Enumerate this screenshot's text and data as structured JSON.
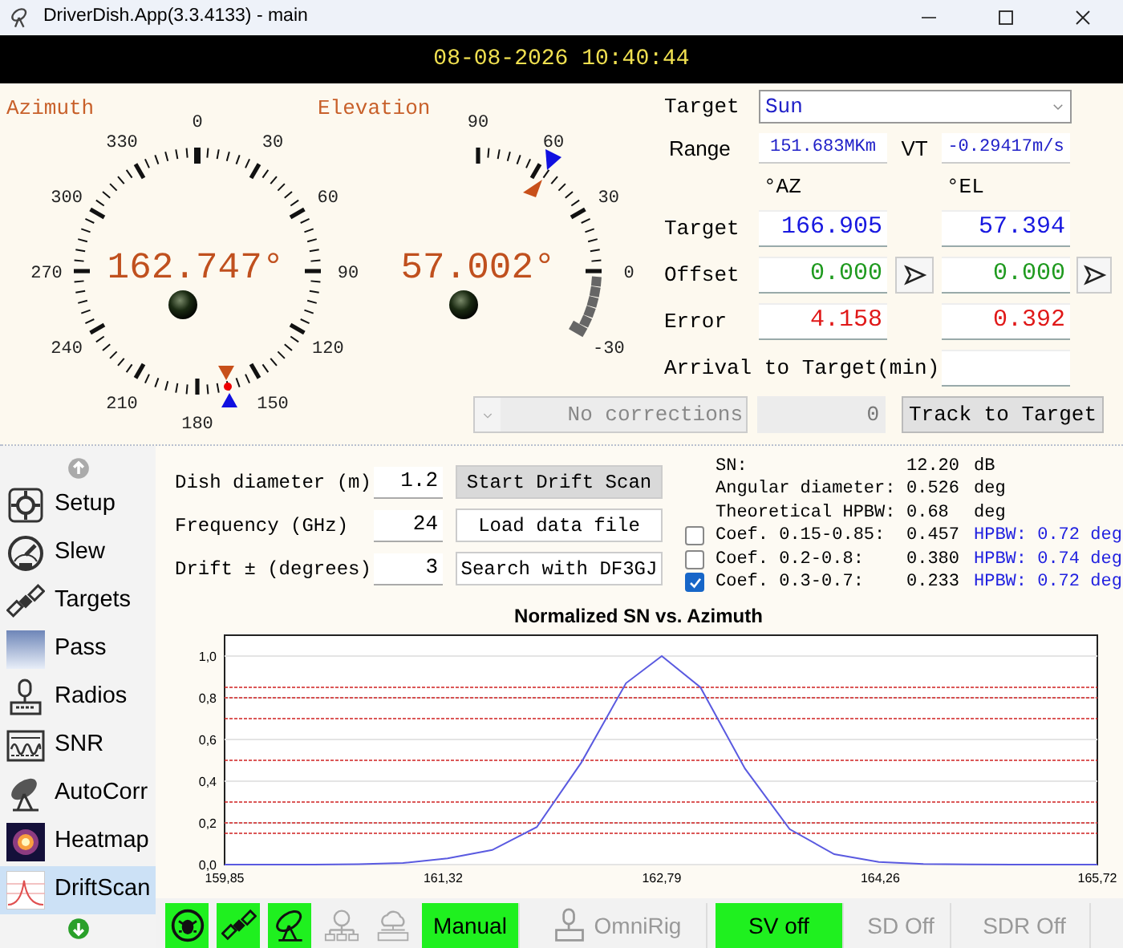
{
  "window": {
    "title": "DriverDish.App(3.3.4133) - main"
  },
  "clock": "08-08-2026 10:40:44",
  "azimuth": {
    "title": "Azimuth",
    "reading": "162.747°",
    "scale": [
      "0",
      "30",
      "60",
      "90",
      "120",
      "150",
      "180",
      "210",
      "240",
      "270",
      "300",
      "330"
    ]
  },
  "elevation": {
    "title": "Elevation",
    "reading": "57.002°",
    "scale": [
      "90",
      "60",
      "30",
      "0",
      "-30"
    ]
  },
  "target": {
    "label": "Target",
    "value": "Sun"
  },
  "range": {
    "label": "Range",
    "value": "151.683MKm"
  },
  "vt": {
    "label": "VT",
    "value": "-0.29417m/s"
  },
  "columns": [
    "°AZ",
    "°EL"
  ],
  "rows": [
    {
      "kind": "target",
      "label": "Target",
      "az": "166.905",
      "el": "57.394"
    },
    {
      "kind": "offset",
      "label": "Offset",
      "az": "0.000",
      "el": "0.000"
    },
    {
      "kind": "error",
      "label": "Error",
      "az": "4.158",
      "el": "0.392"
    }
  ],
  "arrival": {
    "label": "Arrival to Target(min)"
  },
  "corrections": {
    "value": "No corrections",
    "disabled": true
  },
  "correction_count": "0",
  "track_button": "Track to Target",
  "sidebar": {
    "items": [
      {
        "label": "Setup",
        "selected": false
      },
      {
        "label": "Slew",
        "selected": false
      },
      {
        "label": "Targets",
        "selected": false
      },
      {
        "label": "Pass",
        "selected": false
      },
      {
        "label": "Radios",
        "selected": false
      },
      {
        "label": "SNR",
        "selected": false
      },
      {
        "label": "AutoCorr",
        "selected": false
      },
      {
        "label": "Heatmap",
        "selected": false
      },
      {
        "label": "DriftScan",
        "selected": true
      }
    ]
  },
  "drift": {
    "params": [
      {
        "label": "Dish diameter (m)",
        "value": "1.2"
      },
      {
        "label": "Frequency (GHz)",
        "value": "24"
      },
      {
        "label": "Drift ± (degrees)",
        "value": "3"
      }
    ],
    "buttons": [
      {
        "label": "Start Drift Scan",
        "pressed": true
      },
      {
        "label": "Load data file",
        "pressed": false
      },
      {
        "label": "Search with DF3GJ",
        "pressed": false
      }
    ]
  },
  "stats": [
    {
      "label": "SN:",
      "value": "12.20",
      "unit": "dB"
    },
    {
      "label": "Angular diameter:",
      "value": "0.526",
      "unit": "deg"
    },
    {
      "label": "Theoretical HPBW:",
      "value": "0.68",
      "unit": "deg"
    }
  ],
  "coefs": [
    {
      "label": "Coef. 0.15-0.85:",
      "value": "0.457",
      "hpbw": "HPBW: 0.72 deg",
      "checked": false
    },
    {
      "label": "Coef. 0.2-0.8:",
      "value": "0.380",
      "hpbw": "HPBW: 0.74 deg",
      "checked": false
    },
    {
      "label": "Coef. 0.3-0.7:",
      "value": "0.233",
      "hpbw": "HPBW: 0.72 deg",
      "checked": true
    }
  ],
  "chart_data": {
    "type": "line",
    "title": "Normalized SN vs. Azimuth",
    "x": [
      159.85,
      160.15,
      160.45,
      160.75,
      161.05,
      161.35,
      161.65,
      161.95,
      162.25,
      162.55,
      162.79,
      163.05,
      163.35,
      163.65,
      163.95,
      164.25,
      164.55,
      164.85,
      165.15,
      165.45,
      165.72
    ],
    "series": [
      {
        "color": "#5a5ae0",
        "values": [
          0.0,
          0.0,
          0.0,
          0.002,
          0.008,
          0.03,
          0.07,
          0.18,
          0.49,
          0.87,
          1.0,
          0.85,
          0.46,
          0.17,
          0.05,
          0.012,
          0.003,
          0.001,
          0.0,
          0.0,
          0.0
        ]
      }
    ],
    "xlim": [
      159.85,
      165.72
    ],
    "ylim": [
      0,
      1.1
    ],
    "xticks": [
      {
        "value": 159.85,
        "label": "159,85"
      },
      {
        "value": 161.32,
        "label": "161,32"
      },
      {
        "value": 162.79,
        "label": "162,79"
      },
      {
        "value": 164.26,
        "label": "164,26"
      },
      {
        "value": 165.72,
        "label": "165,72"
      }
    ],
    "yticks": [
      {
        "value": 0,
        "label": "0,0"
      },
      {
        "value": 0.2,
        "label": "0,2"
      },
      {
        "value": 0.4,
        "label": "0,4"
      },
      {
        "value": 0.6,
        "label": "0,6"
      },
      {
        "value": 0.8,
        "label": "0,8"
      },
      {
        "value": 1.0,
        "label": "1,0"
      }
    ],
    "grid": true,
    "ref_lines": [
      {
        "axis": "y",
        "value": 0.15
      },
      {
        "axis": "y",
        "value": 0.2
      },
      {
        "axis": "y",
        "value": 0.3
      },
      {
        "axis": "y",
        "value": 0.5
      },
      {
        "axis": "y",
        "value": 0.7
      },
      {
        "axis": "y",
        "value": 0.8
      },
      {
        "axis": "y",
        "value": 0.85
      }
    ]
  },
  "toolbar": {
    "icon_buttons": [
      {
        "on": true
      },
      {
        "on": true
      },
      {
        "on": true
      },
      {
        "on": false
      },
      {
        "on": false
      }
    ],
    "buttons": [
      {
        "label": "Manual",
        "on": true,
        "kind": "plain"
      },
      {
        "label": "OmniRig",
        "on": false,
        "kind": "icon"
      },
      {
        "label": "SV off",
        "on": true,
        "kind": "plain"
      },
      {
        "label": "SD Off",
        "on": false,
        "kind": "plain"
      },
      {
        "label": "SDR Off",
        "on": false,
        "kind": "plain"
      }
    ]
  }
}
